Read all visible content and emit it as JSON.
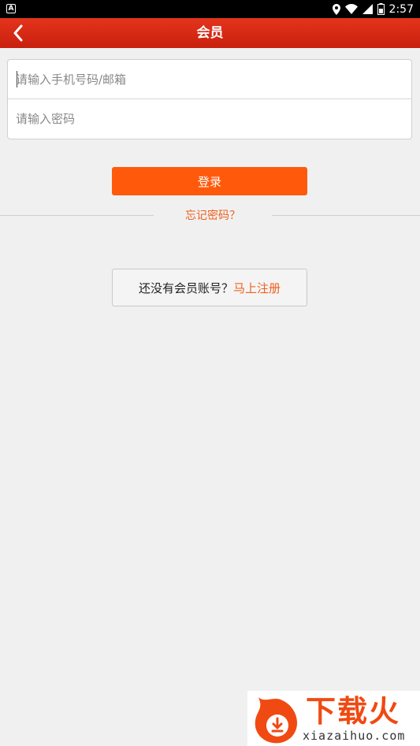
{
  "status_bar": {
    "left_icon": "A",
    "time": "2:57",
    "icons": [
      "location-icon",
      "wifi-icon",
      "signal-icon",
      "battery-icon"
    ]
  },
  "header": {
    "title": "会员",
    "back_icon": "chevron-left-icon"
  },
  "form": {
    "account_placeholder": "请输入手机号码/邮箱",
    "account_value": "",
    "password_placeholder": "请输入密码",
    "password_value": ""
  },
  "login_button_label": "登录",
  "forgot_password_label": "忘记密码？",
  "register": {
    "prompt": "还没有会员账号？",
    "link": "马上注册"
  },
  "watermark": {
    "name": "下载火",
    "url": "xiazaihuo.com"
  },
  "colors": {
    "header": "#d52a14",
    "accent": "#ff5a0c",
    "link": "#f0601e",
    "background": "#f0f0f0"
  }
}
